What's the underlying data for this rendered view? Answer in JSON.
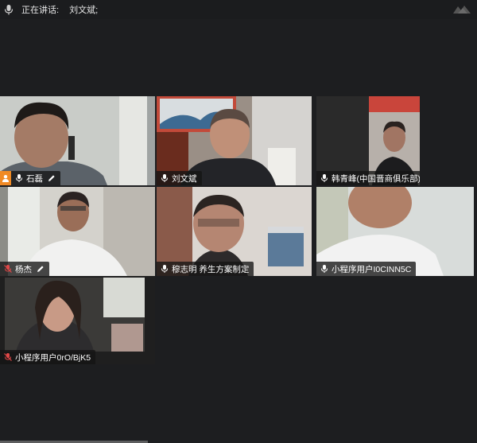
{
  "topbar": {
    "speaking_label": "正在讲话:",
    "speaker_name": "刘文斌;"
  },
  "participants": [
    {
      "name": "石磊",
      "is_host": true,
      "editable": true,
      "muted": false
    },
    {
      "name": "刘文斌",
      "is_host": false,
      "editable": false,
      "muted": false,
      "active_speaker": true
    },
    {
      "name": "韩青峰(中国晋商俱乐部)",
      "is_host": false,
      "editable": false,
      "muted": false
    },
    {
      "name": "杨杰",
      "is_host": false,
      "editable": true,
      "muted": true
    },
    {
      "name": "穆志明 养生方案制定",
      "is_host": false,
      "editable": false,
      "muted": false
    },
    {
      "name": "小程序用户I0CINN5C",
      "is_host": false,
      "editable": false,
      "muted": false
    },
    {
      "name": "小程序用户0rO/BjK5",
      "is_host": false,
      "editable": false,
      "muted": true
    }
  ],
  "colors": {
    "background": "#1d1e20",
    "active_border": "#2fc36d",
    "host_badge": "#f08a24",
    "muted_icon": "#e04848"
  }
}
